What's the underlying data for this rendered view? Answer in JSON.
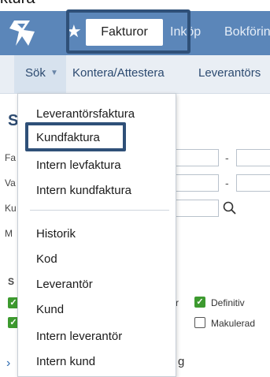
{
  "caption": "ktura",
  "topnav": {
    "fakturor": "Fakturor",
    "inkop": "Inköp",
    "bokforing": "Bokförin"
  },
  "subnav": {
    "sok": "Sök",
    "kontera": "Kontera/Attestera",
    "leverantors": "Leverantörs"
  },
  "page": {
    "title_fragment": "S",
    "label_fragments": [
      "Fa",
      "Va",
      "Ku",
      "M",
      "S"
    ],
    "dash": "-",
    "options": [
      {
        "label": "r",
        "checked": true
      },
      {
        "label": "Definitiv",
        "checked": true
      },
      {
        "label": "Makulerad",
        "checked": false
      }
    ],
    "footer_fragment": "g"
  },
  "menu": {
    "group1": [
      "Leverantörsfaktura",
      "Kundfaktura",
      "Intern levfaktura",
      "Intern kundfaktura"
    ],
    "group2": [
      "Historik",
      "Kod",
      "Leverantör",
      "Kund",
      "Intern leverantör",
      "Intern kund"
    ],
    "highlighted": "Kundfaktura"
  },
  "colors": {
    "topbar": "#5b86b9",
    "subbar": "#e9eef4",
    "highlight_border": "#2f5078",
    "check_green": "#3d9a2f"
  }
}
